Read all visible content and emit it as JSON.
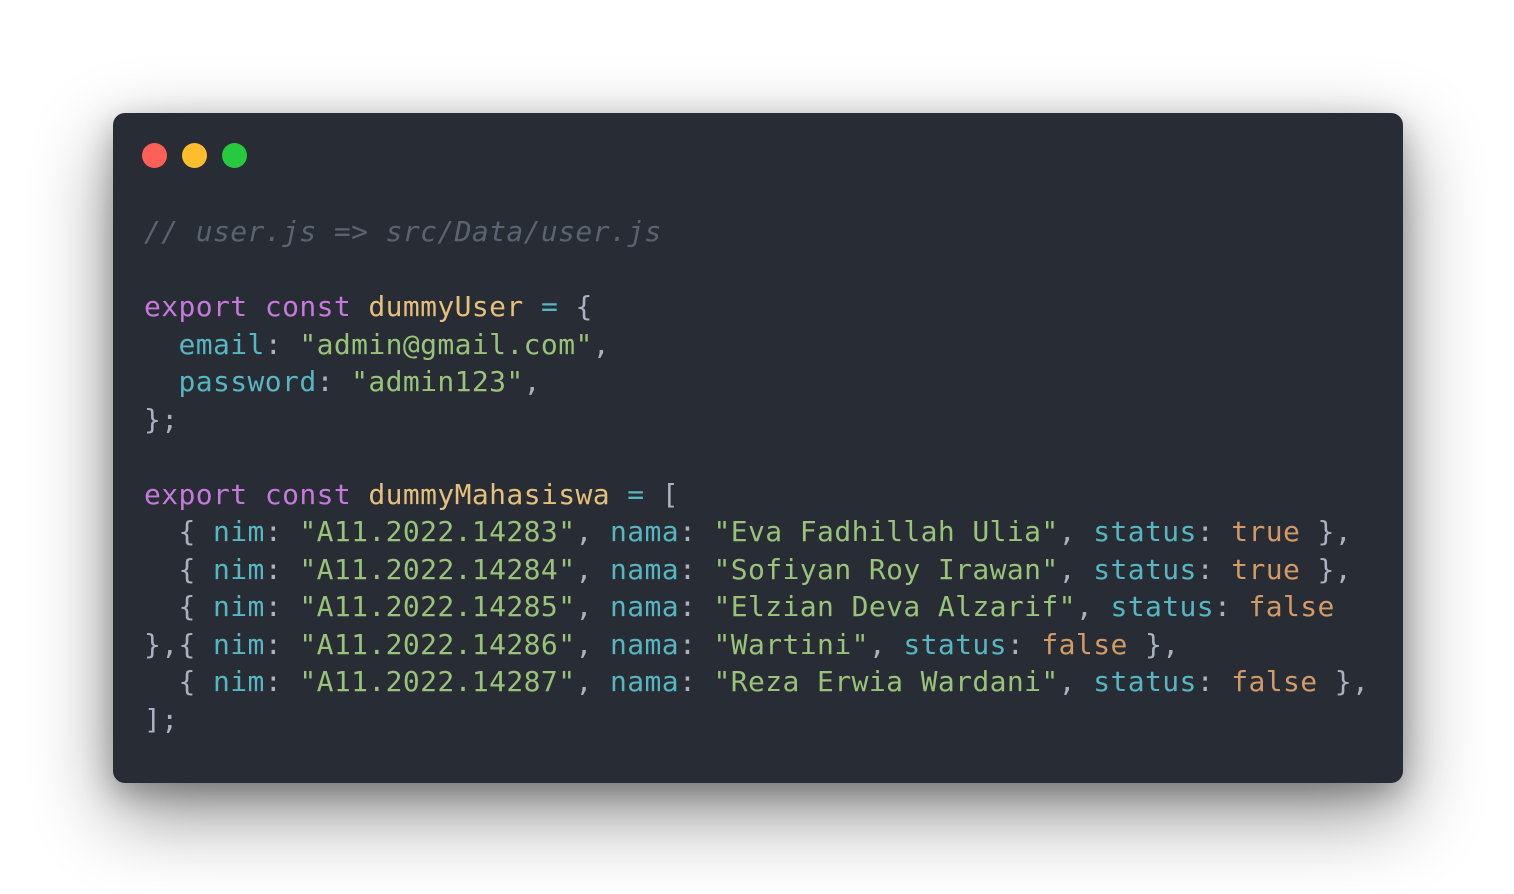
{
  "window": {
    "traffic_lights": {
      "close_color": "#ff5f56",
      "minimize_color": "#ffbd2e",
      "maximize_color": "#27c93f"
    }
  },
  "code": {
    "comment": "// user.js => src/Data/user.js",
    "kw_export": "export",
    "kw_const": "const",
    "user_name": "dummyUser",
    "mahasiswa_name": "dummyMahasiswa",
    "user_fields": [
      {
        "key": "email",
        "value": "\"admin@gmail.com\""
      },
      {
        "key": "password",
        "value": "\"admin123\""
      }
    ],
    "rows": [
      {
        "nim": "\"A11.2022.14283\"",
        "nama": "\"Eva Fadhillah Ulia\"",
        "status": "true"
      },
      {
        "nim": "\"A11.2022.14284\"",
        "nama": "\"Sofiyan Roy Irawan\"",
        "status": "true"
      },
      {
        "nim": "\"A11.2022.14285\"",
        "nama": "\"Elzian Deva Alzarif\"",
        "status": "false"
      },
      {
        "nim": "\"A11.2022.14286\"",
        "nama": "\"Wartini\"",
        "status": "false"
      },
      {
        "nim": "\"A11.2022.14287\"",
        "nama": "\"Reza Erwia Wardani\"",
        "status": "false"
      }
    ]
  },
  "colors": {
    "background": "#282c34",
    "comment": "#5c6370",
    "keyword": "#c678dd",
    "identifier": "#e5c07b",
    "property": "#56b6c2",
    "string": "#98c379",
    "boolean": "#d19a66"
  }
}
